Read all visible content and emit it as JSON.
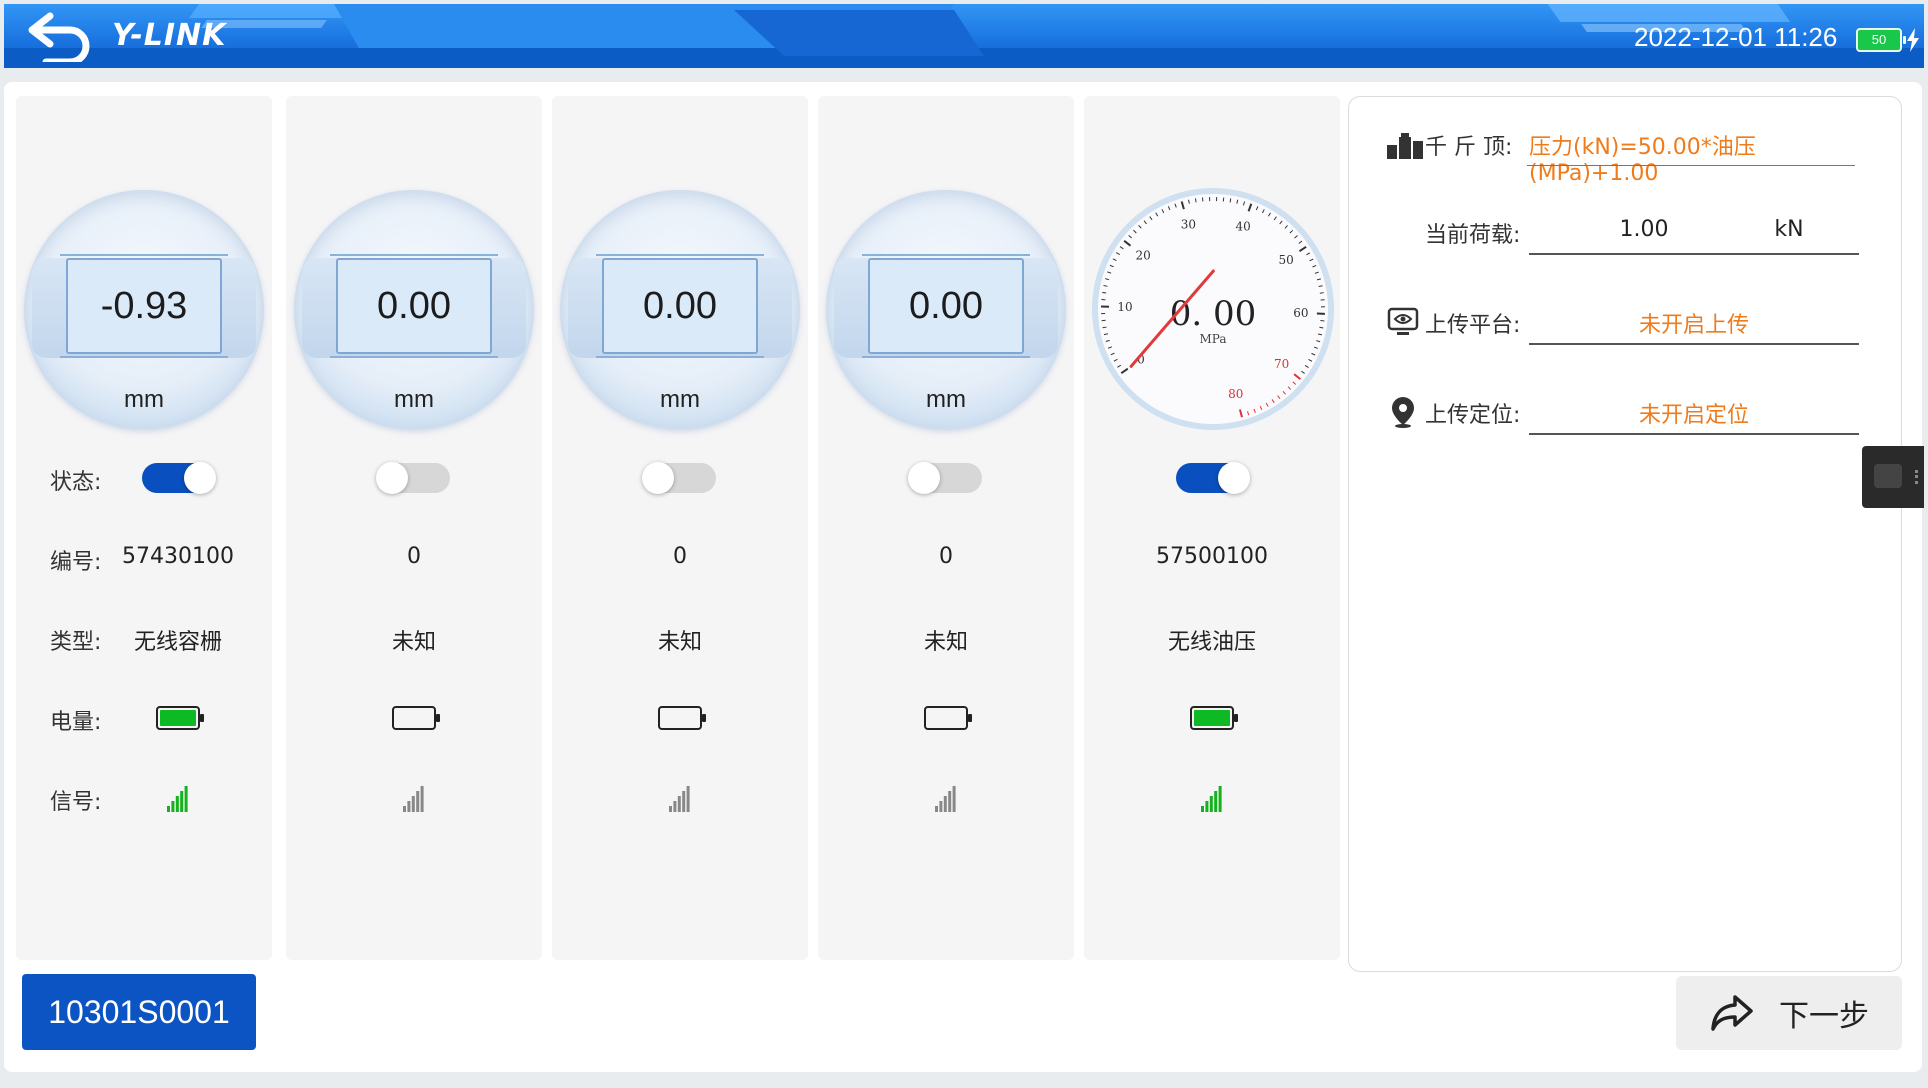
{
  "header": {
    "logo": "Y-LINK",
    "datetime": "2022-12-01  11:26",
    "battery_level": "50",
    "colors": {
      "bar": "#1d78e6"
    }
  },
  "labels": {
    "status": "状态:",
    "number": "编号:",
    "type": "类型:",
    "power": "电量:",
    "signal": "信号:"
  },
  "channels": [
    {
      "value": "-0.93",
      "unit": "mm",
      "enabled": true,
      "number": "57430100",
      "type": "无线容栅",
      "battery": 1.0,
      "signal_active": true
    },
    {
      "value": "0.00",
      "unit": "mm",
      "enabled": false,
      "number": "0",
      "type": "未知",
      "battery": 0.0,
      "signal_active": false
    },
    {
      "value": "0.00",
      "unit": "mm",
      "enabled": false,
      "number": "0",
      "type": "未知",
      "battery": 0.0,
      "signal_active": false
    },
    {
      "value": "0.00",
      "unit": "mm",
      "enabled": false,
      "number": "0",
      "type": "未知",
      "battery": 0.0,
      "signal_active": false
    },
    {
      "value": "0.00",
      "unit": "MPa",
      "enabled": true,
      "number": "57500100",
      "type": "无线油压",
      "battery": 1.0,
      "signal_active": true
    }
  ],
  "gauge": {
    "value": 0.0,
    "display": "0. 00",
    "unit": "MPa",
    "ticks": [
      "0",
      "10",
      "20",
      "30",
      "40",
      "50",
      "60",
      "70",
      "80"
    ]
  },
  "right_panel": {
    "jack_label": "千 斤 顶:",
    "jack_formula": "压力(kN)=50.00*油压(MPa)+1.00",
    "load_label": "当前荷载:",
    "load_value": "1.00",
    "load_unit": "kN",
    "platform_label": "上传平台:",
    "platform_value": "未开启上传",
    "location_label": "上传定位:",
    "location_value": "未开启定位"
  },
  "footer": {
    "code": "10301S0001",
    "next_label": "下一步"
  }
}
